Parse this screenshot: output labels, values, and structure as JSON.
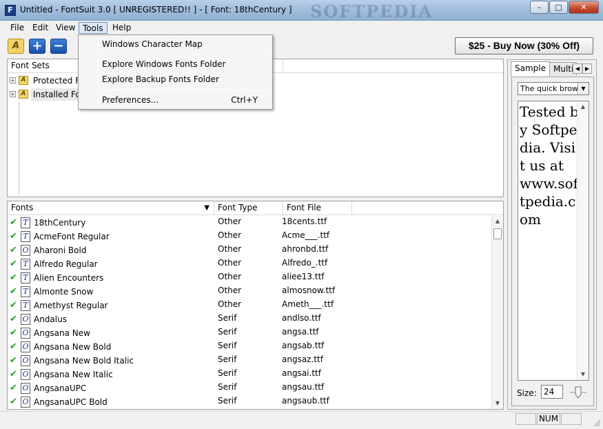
{
  "window": {
    "title": "Untitled - FontSuit 3.0 [ UNREGISTERED!! ]  -  [ Font:  18thCentury ]",
    "watermark": "SOFTPEDIA",
    "app_icon_glyph": "F",
    "minimize": "–",
    "maximize": "□",
    "close": "✕"
  },
  "menubar": {
    "file": "File",
    "edit": "Edit",
    "view": "View",
    "tools": "Tools",
    "help": "Help"
  },
  "toolbar": {
    "folder_glyph": "A",
    "add_glyph": "+",
    "remove_glyph": "−",
    "buy_label": "$25 - Buy Now (30% Off)"
  },
  "tools_menu": {
    "items": [
      {
        "label": "Windows Character Map",
        "shortcut": ""
      },
      {
        "label": "Explore Windows Fonts Folder",
        "shortcut": ""
      },
      {
        "label": "Explore Backup Fonts Folder",
        "shortcut": ""
      },
      {
        "label": "Preferences...",
        "shortcut": "Ctrl+Y"
      }
    ]
  },
  "font_sets": {
    "header": "Font Sets",
    "items": [
      {
        "label": "Protected Fo",
        "expander": "+"
      },
      {
        "label": "Installed Fon",
        "expander": "+"
      }
    ]
  },
  "fonts_list": {
    "columns": {
      "name": "Fonts",
      "type": "Font Type",
      "file": "Font File"
    },
    "sort_arrow": "▼",
    "rows": [
      {
        "name": "18thCentury",
        "type": "Other",
        "file": "18cents.ttf",
        "icon": "T"
      },
      {
        "name": "AcmeFont Regular",
        "type": "Other",
        "file": "Acme___.ttf",
        "icon": "T"
      },
      {
        "name": "Aharoni Bold",
        "type": "Other",
        "file": "ahronbd.ttf",
        "icon": "O"
      },
      {
        "name": "Alfredo Regular",
        "type": "Other",
        "file": "Alfredo_.ttf",
        "icon": "T"
      },
      {
        "name": "Alien Encounters",
        "type": "Other",
        "file": "aliee13.ttf",
        "icon": "T"
      },
      {
        "name": "Almonte Snow",
        "type": "Other",
        "file": "almosnow.ttf",
        "icon": "T"
      },
      {
        "name": "Amethyst Regular",
        "type": "Other",
        "file": "Ameth___.ttf",
        "icon": "T"
      },
      {
        "name": "Andalus",
        "type": "Serif",
        "file": "andlso.ttf",
        "icon": "O"
      },
      {
        "name": "Angsana New",
        "type": "Serif",
        "file": "angsa.ttf",
        "icon": "O"
      },
      {
        "name": "Angsana New Bold",
        "type": "Serif",
        "file": "angsab.ttf",
        "icon": "O"
      },
      {
        "name": "Angsana New Bold Italic",
        "type": "Serif",
        "file": "angsaz.ttf",
        "icon": "O"
      },
      {
        "name": "Angsana New Italic",
        "type": "Serif",
        "file": "angsai.ttf",
        "icon": "O"
      },
      {
        "name": "AngsanaUPC",
        "type": "Serif",
        "file": "angsau.ttf",
        "icon": "O"
      },
      {
        "name": "AngsanaUPC Bold",
        "type": "Serif",
        "file": "angsaub.ttf",
        "icon": "O"
      }
    ],
    "check_glyph": "✔"
  },
  "scrollbar": {
    "up": "▲",
    "down": "▼"
  },
  "preview": {
    "tabs": [
      "Sample",
      "Multip"
    ],
    "tab_left": "◀",
    "tab_right": "▶",
    "sample_select": "The quick brown",
    "select_arrow": "▼",
    "sample_text": "Tested by Softpedia. Visit us at www.softpedia.com",
    "size_label": "Size:",
    "size_value": "24"
  },
  "statusbar": {
    "num": "NUM"
  }
}
